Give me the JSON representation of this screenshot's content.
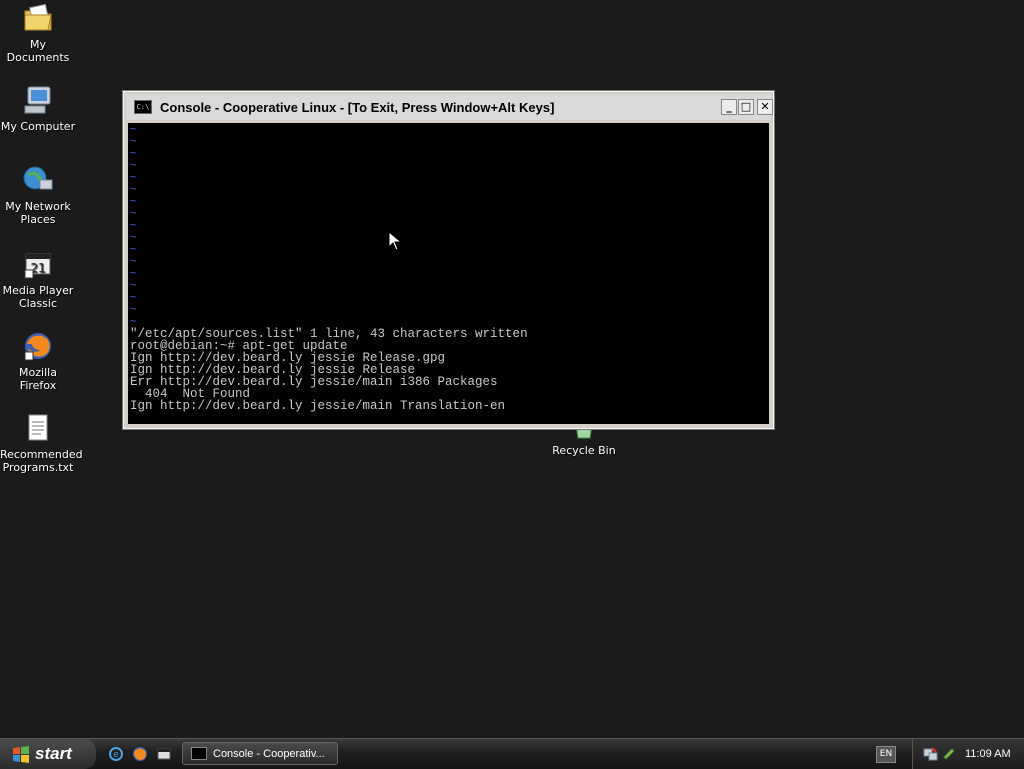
{
  "desktop": {
    "icons": [
      {
        "label": "My Documents",
        "icon": "folder-documents-icon"
      },
      {
        "label": "My Computer",
        "icon": "computer-icon"
      },
      {
        "label": "My Network Places",
        "icon": "network-icon"
      },
      {
        "label": "Media Player Classic",
        "icon": "media-player-icon"
      },
      {
        "label": "Mozilla Firefox",
        "icon": "firefox-icon"
      },
      {
        "label": "Recommended Programs.txt",
        "icon": "text-file-icon"
      }
    ],
    "recycle_bin": {
      "label": "Recycle Bin",
      "icon": "recycle-bin-icon"
    }
  },
  "window": {
    "title": "Console - Cooperative Linux - [To Exit, Press Window+Alt Keys]",
    "minimize": "_",
    "maximize": "□",
    "close": "✕",
    "tilde_char": "~",
    "terminal_lines": [
      "\"/etc/apt/sources.list\" 1 line, 43 characters written",
      "root@debian:~# apt-get update",
      "Ign http://dev.beard.ly jessie Release.gpg",
      "Ign http://dev.beard.ly jessie Release",
      "Err http://dev.beard.ly jessie/main i386 Packages",
      "  404  Not Found",
      "Ign http://dev.beard.ly jessie/main Translation-en"
    ]
  },
  "taskbar": {
    "start_label": "start",
    "task_button": "Console - Cooperativ...",
    "language": "EN",
    "clock": "11:09 AM"
  },
  "colors": {
    "desktop_bg": "#1b1b1b",
    "console_bg": "#000000",
    "tilde": "#3a5ad6"
  }
}
